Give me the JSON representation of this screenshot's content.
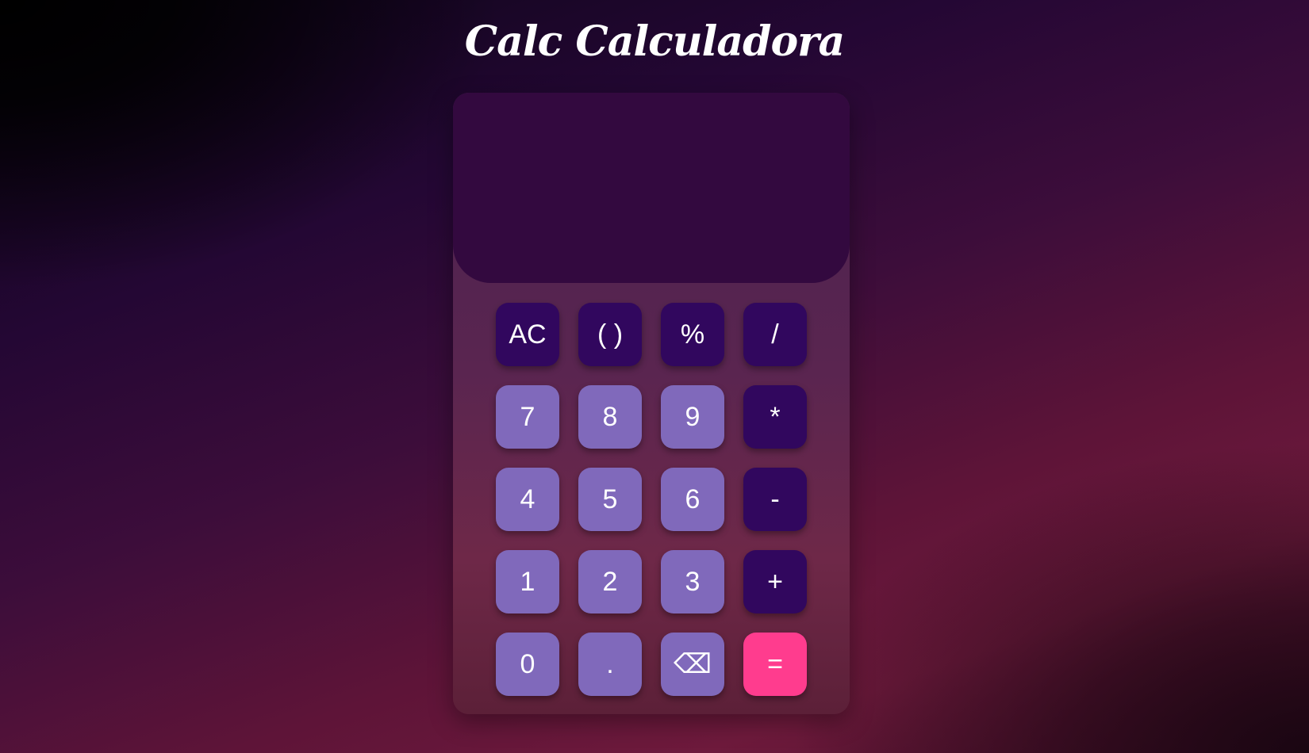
{
  "app": {
    "title": "Calc Calculadora"
  },
  "display": {
    "value": ""
  },
  "keys": {
    "clear": "AC",
    "parens": "( )",
    "percent": "%",
    "divide": "/",
    "seven": "7",
    "eight": "8",
    "nine": "9",
    "multiply": "*",
    "four": "4",
    "five": "5",
    "six": "6",
    "subtract": "-",
    "one": "1",
    "two": "2",
    "three": "3",
    "add": "+",
    "zero": "0",
    "decimal": ".",
    "backspace": "⌫",
    "equals": "="
  },
  "colors": {
    "operator_key": "#31075e",
    "number_key": "#8069bb",
    "equals_key": "#ff3c8e",
    "display_bg": "#33093f"
  },
  "icons": {
    "backspace": "backspace-icon"
  }
}
